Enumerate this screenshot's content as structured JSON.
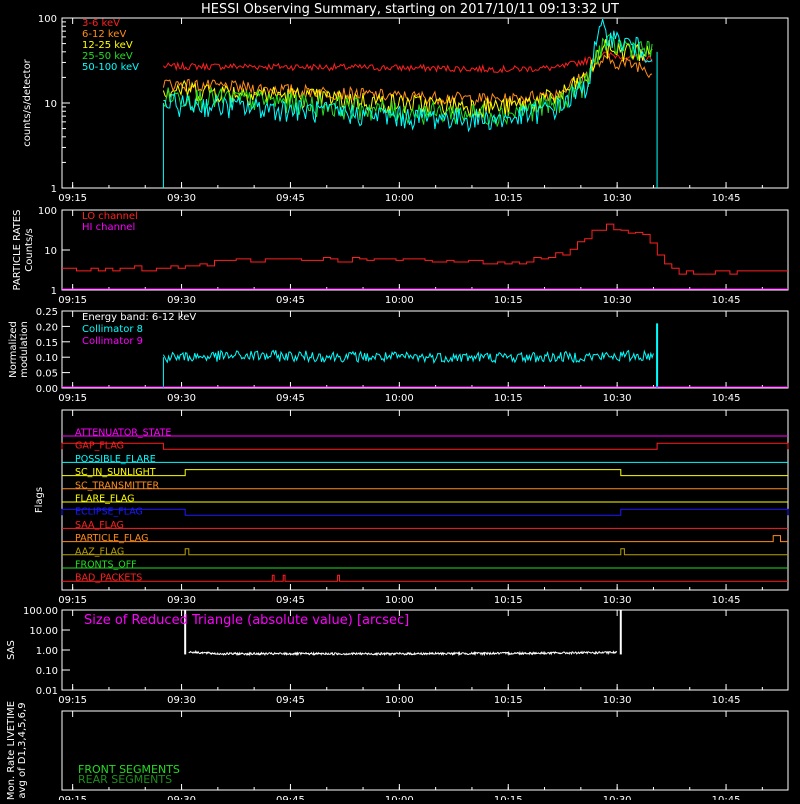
{
  "title": "HESSI Observing Summary, starting on 2017/10/11 09:13:32 UT",
  "time_ticks": [
    "09:15",
    "09:30",
    "09:45",
    "10:00",
    "10:15",
    "10:30",
    "10:45"
  ],
  "colors": {
    "background": "#000000",
    "axes": "#ffffff",
    "red": "#ff2020",
    "orange": "#ff8c1a",
    "yellow": "#ffff00",
    "green": "#22dd22",
    "cyan": "#00ffff",
    "magenta": "#ff00ff",
    "blue": "#1a1aff",
    "olive": "#b8a000"
  },
  "chart_data": [
    {
      "type": "line",
      "panel": "count rates",
      "ylabel": "counts/s/detector",
      "yscale": "log",
      "ylim": [
        1,
        100
      ],
      "ytick_labels": [
        "1",
        "10",
        "100"
      ],
      "x_unit": "UT",
      "xlim": [
        "09:13:32",
        "10:53:32"
      ],
      "data_start": "09:27:30",
      "data_end": "10:35:30",
      "series": [
        {
          "name": "3-6 keV",
          "color": "#ff2020",
          "x": [
            "09:27:30",
            "09:40",
            "10:00",
            "10:15",
            "10:22",
            "10:26",
            "10:28",
            "10:30",
            "10:33",
            "10:35"
          ],
          "y": [
            27,
            27,
            26,
            25,
            26,
            32,
            38,
            36,
            34,
            33
          ]
        },
        {
          "name": "6-12 keV",
          "color": "#ff8c1a",
          "x": [
            "09:27:30",
            "09:40",
            "10:00",
            "10:15",
            "10:22",
            "10:26",
            "10:28",
            "10:30",
            "10:33",
            "10:35"
          ],
          "y": [
            17,
            15,
            12,
            11,
            13,
            22,
            32,
            30,
            28,
            22
          ]
        },
        {
          "name": "12-25 keV",
          "color": "#ffff00",
          "x": [
            "09:27:30",
            "09:40",
            "10:00",
            "10:15",
            "10:22",
            "10:26",
            "10:28",
            "10:30",
            "10:33",
            "10:35"
          ],
          "y": [
            15,
            13,
            10,
            9,
            12,
            20,
            45,
            42,
            40,
            38
          ]
        },
        {
          "name": "25-50 keV",
          "color": "#22dd22",
          "x": [
            "09:27:30",
            "09:40",
            "10:00",
            "10:15",
            "10:22",
            "10:26",
            "10:28",
            "10:30",
            "10:33",
            "10:35"
          ],
          "y": [
            12,
            11,
            8,
            7.5,
            10,
            18,
            50,
            48,
            45,
            40
          ]
        },
        {
          "name": "50-100 keV",
          "color": "#00ffff",
          "x": [
            "09:27:30",
            "09:40",
            "10:00",
            "10:15",
            "10:22",
            "10:26",
            "10:28",
            "10:30",
            "10:33",
            "10:35"
          ],
          "y": [
            10,
            9,
            7,
            6.5,
            9,
            16,
            75,
            55,
            45,
            38
          ]
        }
      ]
    },
    {
      "type": "line",
      "panel": "particle rates",
      "ylabel": "PARTICLE RATES Counts/s",
      "yscale": "log",
      "ylim": [
        1,
        100
      ],
      "ytick_labels": [
        "1",
        "10",
        "100"
      ],
      "series": [
        {
          "name": "LO channel",
          "color": "#ff2020",
          "x": [
            "09:13:32",
            "09:30",
            "09:35",
            "09:45",
            "10:00",
            "10:15",
            "10:20",
            "10:24",
            "10:26",
            "10:28",
            "10:30",
            "10:33",
            "10:36",
            "10:38",
            "10:53:32"
          ],
          "y": [
            3,
            3.5,
            5,
            6,
            5.5,
            5,
            6,
            10,
            25,
            40,
            35,
            25,
            6,
            3,
            3
          ]
        },
        {
          "name": "HI channel",
          "color": "#ff00ff",
          "x": [
            "09:13:32",
            "10:53:32"
          ],
          "y": [
            1,
            1
          ]
        }
      ]
    },
    {
      "type": "line",
      "panel": "modulation",
      "ylabel": "Normalized modulation",
      "ylim": [
        0,
        0.25
      ],
      "ytick_labels": [
        "0.00",
        "0.05",
        "0.10",
        "0.15",
        "0.20",
        "0.25"
      ],
      "annotation": "Energy band: 6-12 keV",
      "series": [
        {
          "name": "Collimator 8",
          "color": "#00ffff",
          "x": [
            "09:27:30",
            "09:40",
            "10:00",
            "10:20",
            "10:35",
            "10:35:30"
          ],
          "y": [
            0.1,
            0.105,
            0.1,
            0.1,
            0.105,
            0.21
          ]
        },
        {
          "name": "Collimator 9",
          "color": "#ff00ff",
          "x": [
            "09:13:32",
            "10:53:32"
          ],
          "y": [
            0.0,
            0.0
          ]
        }
      ]
    },
    {
      "type": "line",
      "panel": "flags",
      "ylabel": "Flags",
      "flags": [
        {
          "name": "ATTENUATOR_STATE",
          "color": "#ff00ff",
          "segments": []
        },
        {
          "name": "GAP_FLAG",
          "color": "#ff2020",
          "segments": [
            [
              "09:13:32",
              "09:27:30"
            ],
            [
              "10:35:30",
              "10:53:32"
            ]
          ]
        },
        {
          "name": "POSSIBLE_FLARE",
          "color": "#00ffff",
          "segments": []
        },
        {
          "name": "SC_IN_SUNLIGHT",
          "color": "#ffff00",
          "segments": [
            [
              "09:30:30",
              "10:30:30"
            ]
          ]
        },
        {
          "name": "SC_TRANSMITTER",
          "color": "#ff8c1a",
          "segments": []
        },
        {
          "name": "FLARE_FLAG",
          "color": "#ffff00",
          "segments": []
        },
        {
          "name": "ECLIPSE_FLAG",
          "color": "#1a1aff",
          "segments": [
            [
              "09:13:32",
              "09:30:30"
            ],
            [
              "10:30:30",
              "10:53:32"
            ]
          ]
        },
        {
          "name": "SAA_FLAG",
          "color": "#ff2020",
          "segments": []
        },
        {
          "name": "PARTICLE_FLAG",
          "color": "#ff8c1a",
          "segments": [
            [
              "10:51:30",
              "10:52:30"
            ]
          ]
        },
        {
          "name": "AAZ_FLAG",
          "color": "#b8a000",
          "segments": [
            [
              "09:30:30",
              "09:31"
            ],
            [
              "10:30:30",
              "10:31"
            ]
          ]
        },
        {
          "name": "FRONTS_OFF",
          "color": "#22dd22",
          "segments": []
        },
        {
          "name": "BAD_PACKETS",
          "color": "#ff2020",
          "segments": [
            [
              "09:42:30",
              "09:42:45"
            ],
            [
              "09:44",
              "09:44:15"
            ],
            [
              "09:51:30",
              "09:51:45"
            ]
          ]
        }
      ]
    },
    {
      "type": "line",
      "panel": "SAS",
      "ylabel": "SAS",
      "yscale": "log",
      "ylim": [
        0.01,
        100
      ],
      "ytick_labels": [
        "0.01",
        "0.10",
        "1.00",
        "10.00",
        "100.00"
      ],
      "annotation": "Size of Reduced Triangle (absolute value) [arcsec]",
      "series": [
        {
          "name": "",
          "color": "#ffffff",
          "x": [
            "09:30:30",
            "09:31",
            "09:35",
            "10:00",
            "10:20",
            "10:30",
            "10:30:30"
          ],
          "y": [
            100,
            0.8,
            0.65,
            0.65,
            0.7,
            0.75,
            100
          ]
        }
      ]
    },
    {
      "type": "line",
      "panel": "monitor rates",
      "ylabel": "Mon. Rate LIVETIME avg of D1,3,4,5,6,9",
      "series": [
        {
          "name": "FRONT SEGMENTS",
          "color": "#22dd22",
          "x": [],
          "y": []
        },
        {
          "name": "REAR SEGMENTS",
          "color": "#1c8f1c",
          "x": [],
          "y": []
        }
      ]
    }
  ]
}
